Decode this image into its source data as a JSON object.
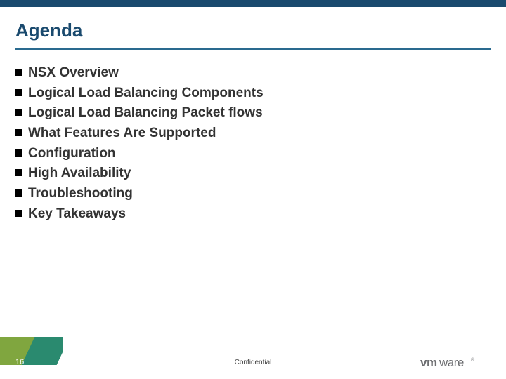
{
  "title": "Agenda",
  "bullets": [
    "NSX Overview",
    "Logical Load Balancing Components",
    "Logical Load Balancing Packet flows",
    "What Features Are Supported",
    "Configuration",
    "High Availability",
    "Troubleshooting",
    "Key Takeaways"
  ],
  "page_number": "16",
  "footer_label": "Confidential",
  "logo_text": "vmware",
  "colors": {
    "brand_dark": "#1a4a6e",
    "accent_green": "#2a8a6f",
    "accent_olive": "#8aa93a"
  }
}
